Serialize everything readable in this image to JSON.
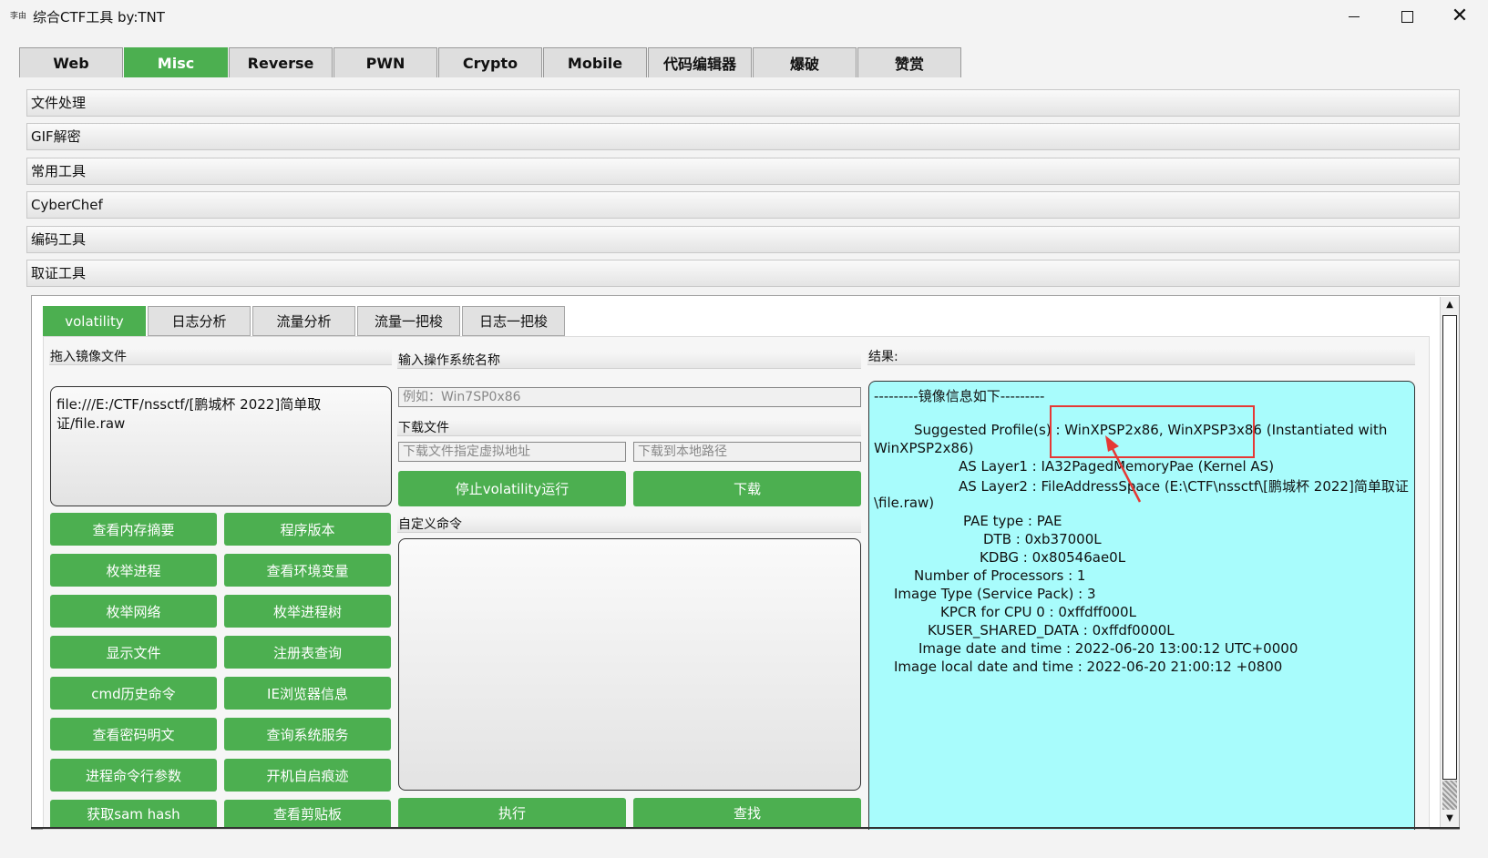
{
  "window": {
    "app_icon": "李由",
    "title": "综合CTF工具    by:TNT",
    "min_icon": "minimize-icon",
    "max_icon": "maximize-icon",
    "close_glyph": "✕"
  },
  "main_tabs": [
    "Web",
    "Misc",
    "Reverse",
    "PWN",
    "Crypto",
    "Mobile",
    "代码编辑器",
    "爆破",
    "赞赏"
  ],
  "active_main_tab": "Misc",
  "sections": [
    "文件处理",
    "GIF解密",
    "常用工具",
    "CyberChef",
    "编码工具",
    "取证工具"
  ],
  "sub_tabs": [
    "volatility",
    "日志分析",
    "流量分析",
    "流量一把梭",
    "日志一把梭"
  ],
  "active_sub_tab": "volatility",
  "left": {
    "drop_label": "拖入镜像文件",
    "file_path": "file:///E:/CTF/nssctf/[鹏城杯 2022]简单取证/file.raw",
    "buttons": [
      "查看内存摘要",
      "程序版本",
      "枚举进程",
      "查看环境变量",
      "枚举网络",
      "枚举进程树",
      "显示文件",
      "注册表查询",
      "cmd历史命令",
      "IE浏览器信息",
      "查看密码明文",
      "查询系统服务",
      "进程命令行参数",
      "开机自启痕迹",
      "获取sam hash",
      "查看剪贴板"
    ]
  },
  "middle": {
    "os_label": "输入操作系统名称",
    "os_placeholder": "例如：Win7SP0x86",
    "download_label": "下载文件",
    "download_addr_placeholder": "下载文件指定虚拟地址",
    "download_path_placeholder": "下载到本地路径",
    "stop_button": "停止volatility运行",
    "download_button": "下载",
    "custom_label": "自定义命令",
    "exec_button": "执行",
    "find_button": "查找"
  },
  "result": {
    "label": "结果:",
    "lines": [
      "---------镜像信息如下---------",
      "",
      "          Suggested Profile(s) :  WinXPSP2x86, WinXPSP3x86 (Instantiated with",
      "WinXPSP2x86)",
      "                     AS Layer1 : IA32PagedMemoryPae (Kernel AS)",
      "                     AS Layer2 : FileAddressSpace (E:\\CTF\\nssctf\\[鹏城杯 2022]简单取证",
      "\\file.raw)",
      "                      PAE type : PAE",
      "                           DTB : 0xb37000L",
      "                          KDBG : 0x80546ae0L",
      "          Number of Processors : 1",
      "     Image Type (Service Pack) : 3",
      "                KPCR for CPU 0 : 0xffdff000L",
      "             KUSER_SHARED_DATA : 0xffdf0000L",
      "           Image date and time : 2022-06-20 13:00:12 UTC+0000",
      "     Image local date and time : 2022-06-20 21:00:12 +0800"
    ]
  },
  "scrollbar": {
    "up": "▲",
    "down": "▼"
  },
  "colors": {
    "accent_green": "#4caf50",
    "result_bg": "#a8fcfc",
    "highlight_red": "#e53935"
  }
}
